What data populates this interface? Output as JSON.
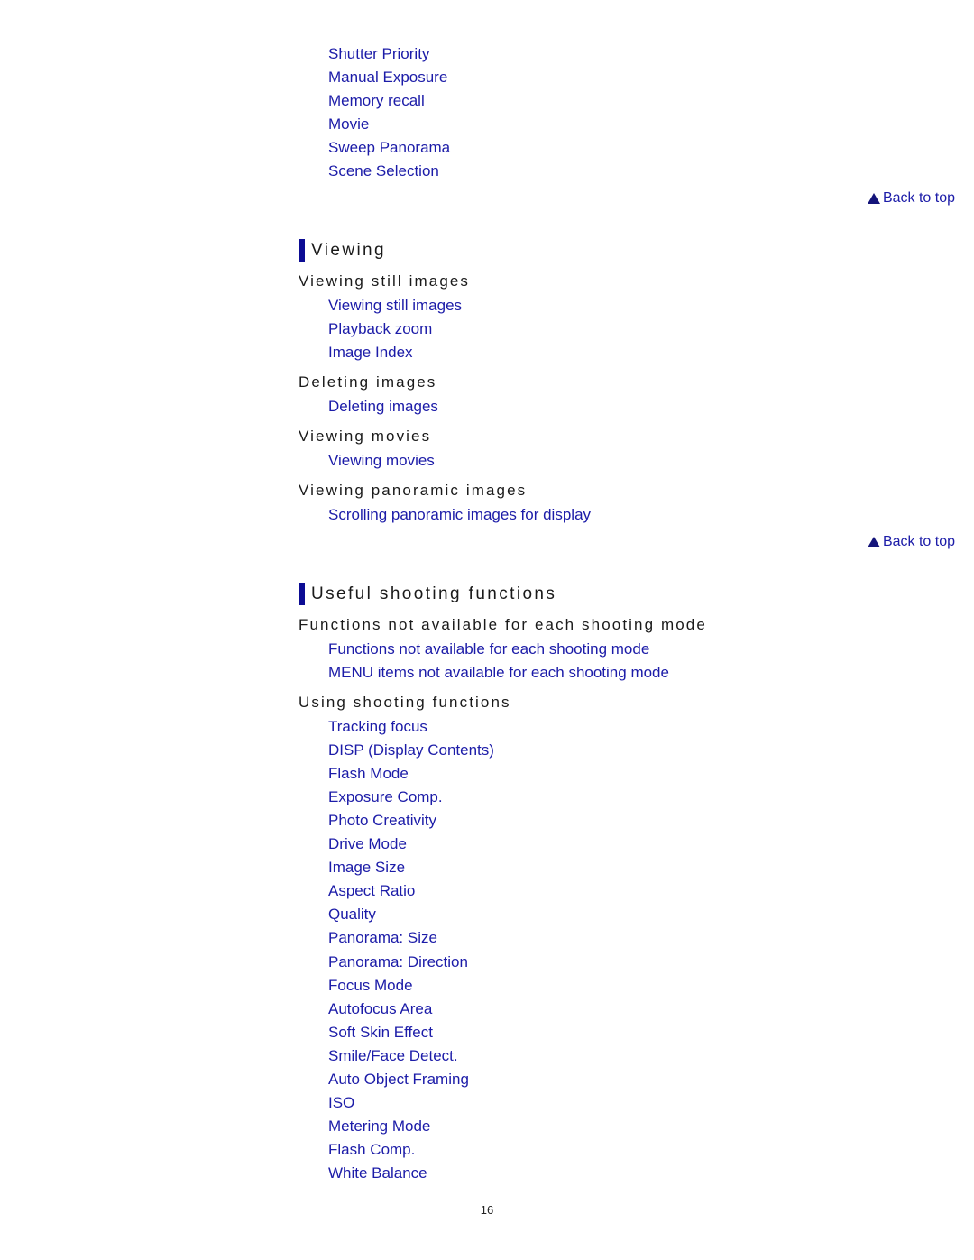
{
  "top_links": [
    "Shutter Priority",
    "Manual Exposure",
    "Memory recall",
    "Movie",
    "Sweep Panorama",
    "Scene Selection"
  ],
  "back_to_top": "Back to top",
  "viewing": {
    "title": "Viewing",
    "groups": [
      {
        "heading": "Viewing still images",
        "links": [
          "Viewing still images",
          "Playback zoom",
          "Image Index"
        ]
      },
      {
        "heading": "Deleting images",
        "links": [
          "Deleting images"
        ]
      },
      {
        "heading": "Viewing movies",
        "links": [
          "Viewing movies"
        ]
      },
      {
        "heading": "Viewing panoramic images",
        "links": [
          "Scrolling panoramic images for display"
        ]
      }
    ]
  },
  "useful": {
    "title": "Useful shooting functions",
    "groups": [
      {
        "heading": "Functions not available for each shooting mode",
        "links": [
          "Functions not available for each shooting mode",
          "MENU items not available for each shooting mode"
        ]
      },
      {
        "heading": "Using shooting functions",
        "links": [
          "Tracking focus",
          "DISP (Display Contents)",
          "Flash Mode",
          "Exposure Comp.",
          "Photo Creativity",
          "Drive Mode",
          "Image Size",
          "Aspect Ratio",
          "Quality",
          "Panorama: Size",
          "Panorama: Direction",
          "Focus Mode",
          "Autofocus Area",
          "Soft Skin Effect",
          "Smile/Face Detect.",
          "Auto Object Framing",
          "ISO",
          "Metering Mode",
          "Flash Comp.",
          "White Balance"
        ]
      }
    ]
  },
  "page_number": "16",
  "colors": {
    "link": "#1c1ca8",
    "section_bar": "#0c0c94",
    "heading": "#1a1a1a"
  }
}
